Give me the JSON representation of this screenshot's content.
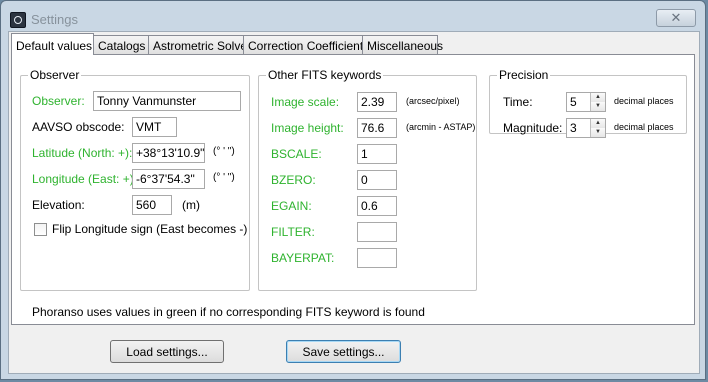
{
  "window": {
    "title": "Settings",
    "close_glyph": "✕"
  },
  "tabs": [
    "Default values",
    "Catalogs",
    "Astrometric Solver",
    "Correction Coefficients",
    "Miscellaneous"
  ],
  "observer": {
    "legend": "Observer",
    "observer_label": "Observer:",
    "observer_value": "Tonny Vanmunster",
    "aavso_label": "AAVSO obscode:",
    "aavso_value": "VMT",
    "latitude_label": "Latitude (North: +):",
    "latitude_value": "+38°13'10.9\"",
    "latitude_unit": "(° ' \")",
    "longitude_label": "Longitude (East: +):",
    "longitude_value": "-6°37'54.3\"",
    "longitude_unit": "(° ' \")",
    "elevation_label": "Elevation:",
    "elevation_value": "560",
    "elevation_unit": "(m)",
    "flip_label": "Flip Longitude sign (East becomes -)",
    "flip_checked": false
  },
  "fits": {
    "legend": "Other FITS keywords",
    "image_scale_label": "Image scale:",
    "image_scale_value": "2.39",
    "image_scale_unit": "(arcsec/pixel)",
    "image_height_label": "Image height:",
    "image_height_value": "76.6",
    "image_height_unit": "(arcmin - ASTAP)",
    "bscale_label": "BSCALE:",
    "bscale_value": "1",
    "bzero_label": "BZERO:",
    "bzero_value": "0",
    "egain_label": "EGAIN:",
    "egain_value": "0.6",
    "filter_label": "FILTER:",
    "filter_value": "",
    "bayerpat_label": "BAYERPAT:",
    "bayerpat_value": ""
  },
  "precision": {
    "legend": "Precision",
    "time_label": "Time:",
    "time_value": "5",
    "time_unit": "decimal places",
    "magnitude_label": "Magnitude:",
    "magnitude_value": "3",
    "magnitude_unit": "decimal places"
  },
  "note": "Phoranso uses values in green if no corresponding FITS keyword is found",
  "buttons": {
    "load": "Load settings...",
    "save": "Save settings..."
  },
  "colors": {
    "green_label": "#2fb32f",
    "titlebar": "#c9d7e4"
  }
}
